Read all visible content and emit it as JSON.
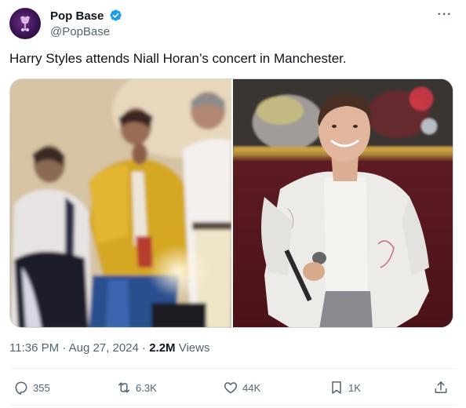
{
  "tweet": {
    "author": {
      "display_name": "Pop Base",
      "handle": "@PopBase",
      "verified": true
    },
    "text": "Harry Styles attends Niall Horan’s concert in Manchester.",
    "time": "11:36 PM",
    "date": "Aug 27, 2024",
    "separator": "·",
    "views_count": "2.2M",
    "views_label": "Views"
  },
  "actions": {
    "reply_count": "355",
    "retweet_count": "6.3K",
    "like_count": "44K",
    "bookmark_count": "1K"
  },
  "icons": {
    "avatar": "pop-base-logo",
    "verified": "verified-badge-icon",
    "more": "more-icon",
    "reply": "reply-icon",
    "retweet": "retweet-icon",
    "like": "heart-icon",
    "bookmark": "bookmark-icon",
    "share": "share-icon"
  },
  "colors": {
    "verified": "#1d9bf0",
    "secondary_text": "#536471",
    "primary_text": "#0f1419",
    "divider": "#eff3f4"
  }
}
